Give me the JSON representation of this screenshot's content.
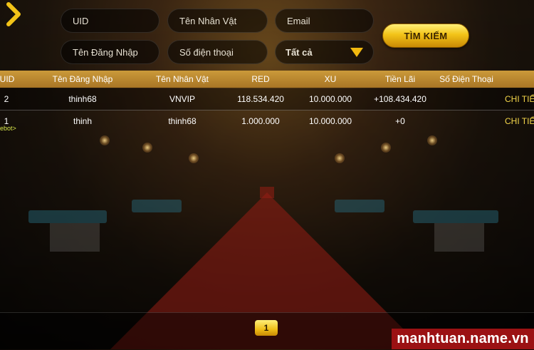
{
  "filters": {
    "uid_placeholder": "UID",
    "character_name_placeholder": "Tên Nhân Vật",
    "email_placeholder": "Email",
    "username_placeholder": "Tên Đăng Nhập",
    "phone_placeholder": "Số điện thoại",
    "status_select_value": "Tất cả",
    "search_label": "TÌM KIẾM"
  },
  "table": {
    "headers": [
      "UID",
      "Tên Đăng Nhập",
      "Tên Nhân Vật",
      "RED",
      "XU",
      "Tiền Lãi",
      "Số Điện Thoại"
    ],
    "rows": [
      {
        "uid": "2",
        "username": "thinh68",
        "character": "VNVIP",
        "red": "118.534.420",
        "xu": "10.000.000",
        "profit": "+108.434.420",
        "phone": "",
        "detail": "CHI TIẾ"
      },
      {
        "uid": "1",
        "username": "thinh",
        "character": "thinh68",
        "red": "1.000.000",
        "xu": "10.000.000",
        "profit": "+0",
        "phone": "",
        "detail": "CHI TIẾ",
        "tag": "ebot>"
      }
    ]
  },
  "pagination": {
    "current_page": "1"
  },
  "watermark": "manhtuan.name.vn",
  "colors": {
    "accent_gold": "#f2c318",
    "header_bar": "#b8862e",
    "detail_link": "#f4d64a",
    "watermark_bg": "#9b1113"
  }
}
